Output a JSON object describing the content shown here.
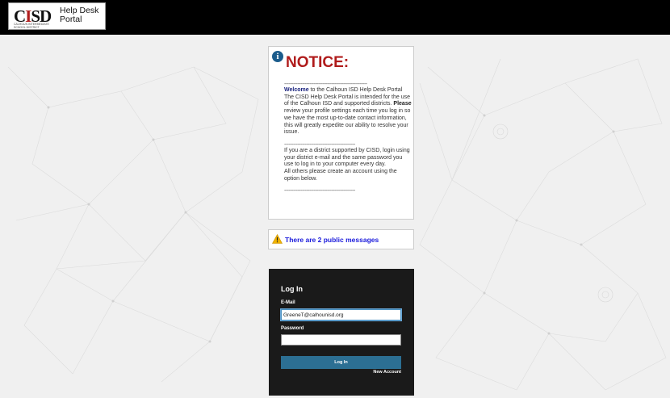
{
  "header": {
    "logo_text": "CISD",
    "logo_subtext": "CALHOUN INTERMEDIATE SCHOOL DISTRICT",
    "portal_title_line1": "Help Desk",
    "portal_title_line2": "Portal"
  },
  "notice": {
    "title": "NOTICE:",
    "divider1": "--------------------------------------------------------",
    "welcome_kw": "Welcome",
    "welcome_rest": " to the Calhoun ISD Help Desk Portal The CISD Help Desk Portal is intended for the use of the Calhoun ISD and supported districts.",
    "please_kw": "Please",
    "please_rest": " review your profile settings each time you log in so we have the most up-to-date contact information, this will greatly expedite our ability to resolve your issue.",
    "divider2": "------------------------------------------------",
    "district_text": "If you are a district supported by CISD, login using your district e-mail and the same password you use to log in to your computer every day.",
    "others_text": "All others please create an account using the option below.",
    "divider3": "------------------------------------------------"
  },
  "messages": {
    "text": "There are 2 public messages"
  },
  "login": {
    "title": "Log In",
    "email_label": "E-Mail",
    "email_value": "GreeneT@calhounisd.org",
    "password_label": "Password",
    "password_value": "",
    "button_label": "Log In",
    "new_account_label": "New Account"
  },
  "colors": {
    "notice_title": "#b01c1c",
    "info_icon": "#1b5c8c",
    "messages_text": "#1a1adb",
    "login_panel": "#1a1a1a",
    "login_button": "#2c6f93",
    "warning_icon": "#f2b400"
  }
}
